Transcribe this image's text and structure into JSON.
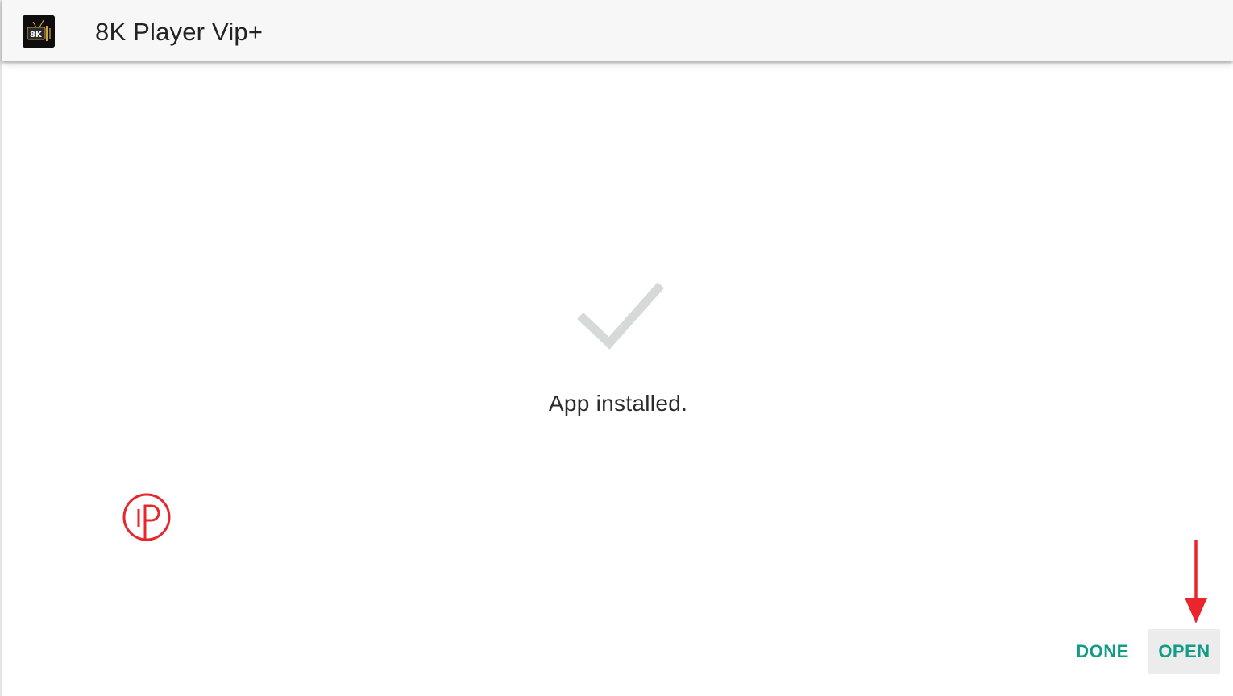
{
  "appbar": {
    "title": "8K Player Vip+",
    "icon": "app-logo-8k-icon",
    "icon_text": "8K"
  },
  "main": {
    "status_icon": "checkmark-icon",
    "status_text": "App installed."
  },
  "overlay": {
    "watermark_icon": "ip-logo-icon",
    "annotation_icon": "red-arrow-down-icon"
  },
  "actions": {
    "done_label": "DONE",
    "open_label": "OPEN"
  },
  "colors": {
    "accent": "#129c87",
    "check": "#d5dad8",
    "annotation": "#e8262b",
    "appbar_bg": "#f7f7f7",
    "open_button_bg": "#ececec"
  }
}
